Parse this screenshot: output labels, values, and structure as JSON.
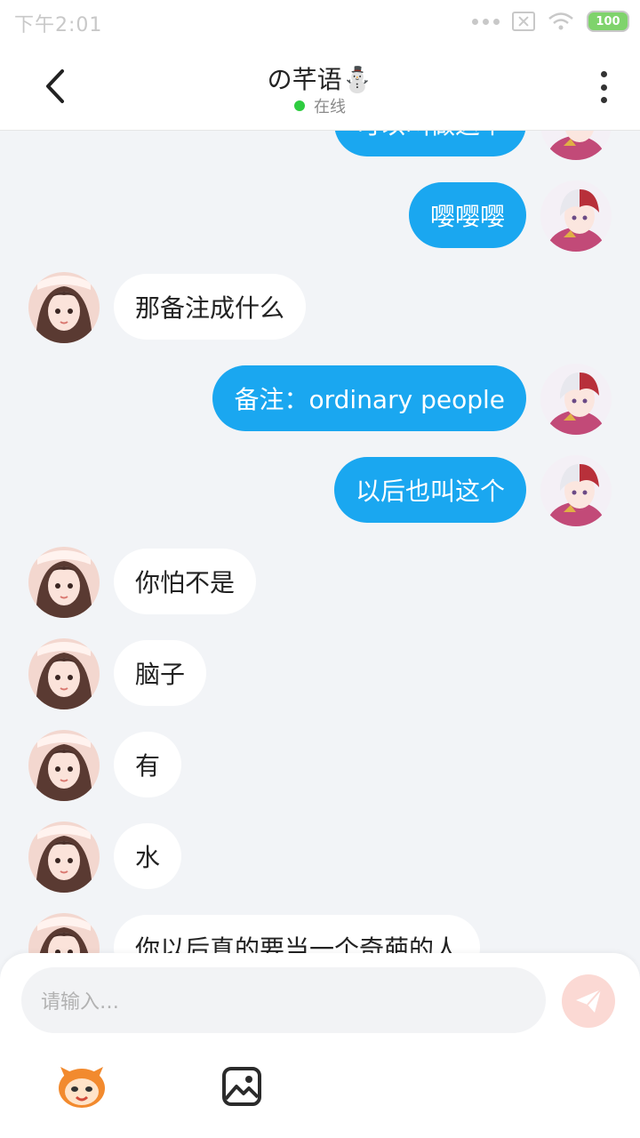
{
  "status_bar": {
    "time": "下午2:01",
    "battery": "100"
  },
  "header": {
    "title": "の芊语⛄",
    "status": "在线"
  },
  "messages": [
    {
      "side": "out",
      "text": "可以叫做这个"
    },
    {
      "side": "out",
      "text": "嘤嘤嘤"
    },
    {
      "side": "in",
      "text": "那备注成什么"
    },
    {
      "side": "out",
      "text": "备注：ordinary people"
    },
    {
      "side": "out",
      "text": "以后也叫这个"
    },
    {
      "side": "in",
      "text": "你怕不是"
    },
    {
      "side": "in",
      "text": "脑子"
    },
    {
      "side": "in",
      "text": "有"
    },
    {
      "side": "in",
      "text": "水"
    },
    {
      "side": "in",
      "text": "你以后真的要当一个奇葩的人"
    }
  ],
  "composer": {
    "placeholder": "请输入…"
  },
  "colors": {
    "outgoing_bubble": "#1aa7f0",
    "incoming_bubble": "#ffffff",
    "send_button": "#fbd9d4",
    "online_dot": "#2ecc40"
  },
  "icons": [
    "back-arrow-icon",
    "more-vertical-icon",
    "send-icon",
    "mascot-icon",
    "image-icon"
  ]
}
